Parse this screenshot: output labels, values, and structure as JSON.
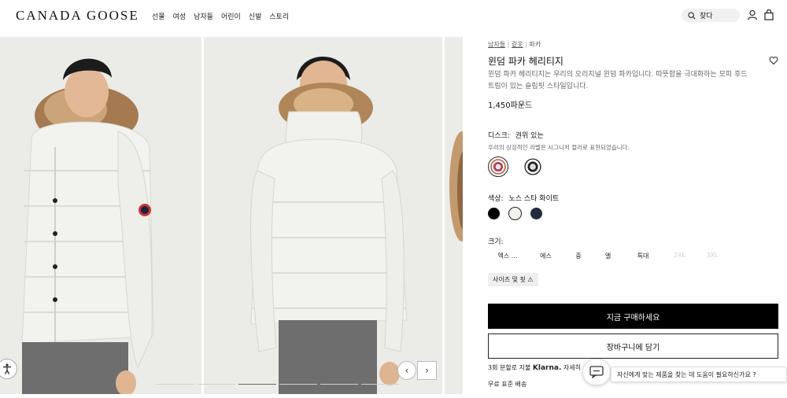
{
  "header": {
    "logo": "CANADA GOOSE",
    "nav": [
      "선물",
      "여성",
      "남자들",
      "어린이",
      "신발",
      "스토리"
    ],
    "search_label": "찾다",
    "icons": [
      "search-icon",
      "account-icon",
      "bag-icon"
    ]
  },
  "product": {
    "breadcrumb": [
      "남자들",
      "겉옷",
      "파카"
    ],
    "title": "윈덤 파카 헤리티지",
    "description": "윈덤 파카 헤리티지는 우리의 오리지널 윈덤 파카입니다. 따뜻함을 극대화하는 모피 후드 트림이 있는 슬림핏 스타일입니다.",
    "price": "1,450파운드",
    "disc_label": "디스크:",
    "disc_value": "권위 있는",
    "disc_note": "우리의 상징적인 라벨은 시그니처 컬러로 표현되었습니다.",
    "color_label": "색상:",
    "color_value": "노스 스타 화이트",
    "colors": [
      "#000000",
      "#f2f2ee",
      "#232a3d"
    ],
    "size_label": "크기:",
    "sizes": [
      {
        "label": "엑스 ...",
        "available": true
      },
      {
        "label": "에스",
        "available": true
      },
      {
        "label": "중",
        "available": true
      },
      {
        "label": "엘",
        "available": true
      },
      {
        "label": "특대",
        "available": true
      },
      {
        "label": "2XL",
        "available": false
      },
      {
        "label": "3XL",
        "available": false
      }
    ],
    "size_fit_label": "사이즈 및 핏 ⚠",
    "buy_now": "지금 구매하세요",
    "add_to_cart": "장바구니에 담기",
    "klarna_prefix": "3회 분할로 지불",
    "klarna_brand": "Klarna.",
    "klarna_suffix": "자세히",
    "shipping": "무료 표준 배송"
  },
  "chat": {
    "prompt": "자신에게 맞는 제품을 찾는 데 도움이 필요하신가요 ?"
  },
  "gallery": {
    "images": [
      "front-view-photo",
      "back-view-photo",
      "fur-hood-detail-photo"
    ],
    "active_index": 2,
    "count": 8
  }
}
